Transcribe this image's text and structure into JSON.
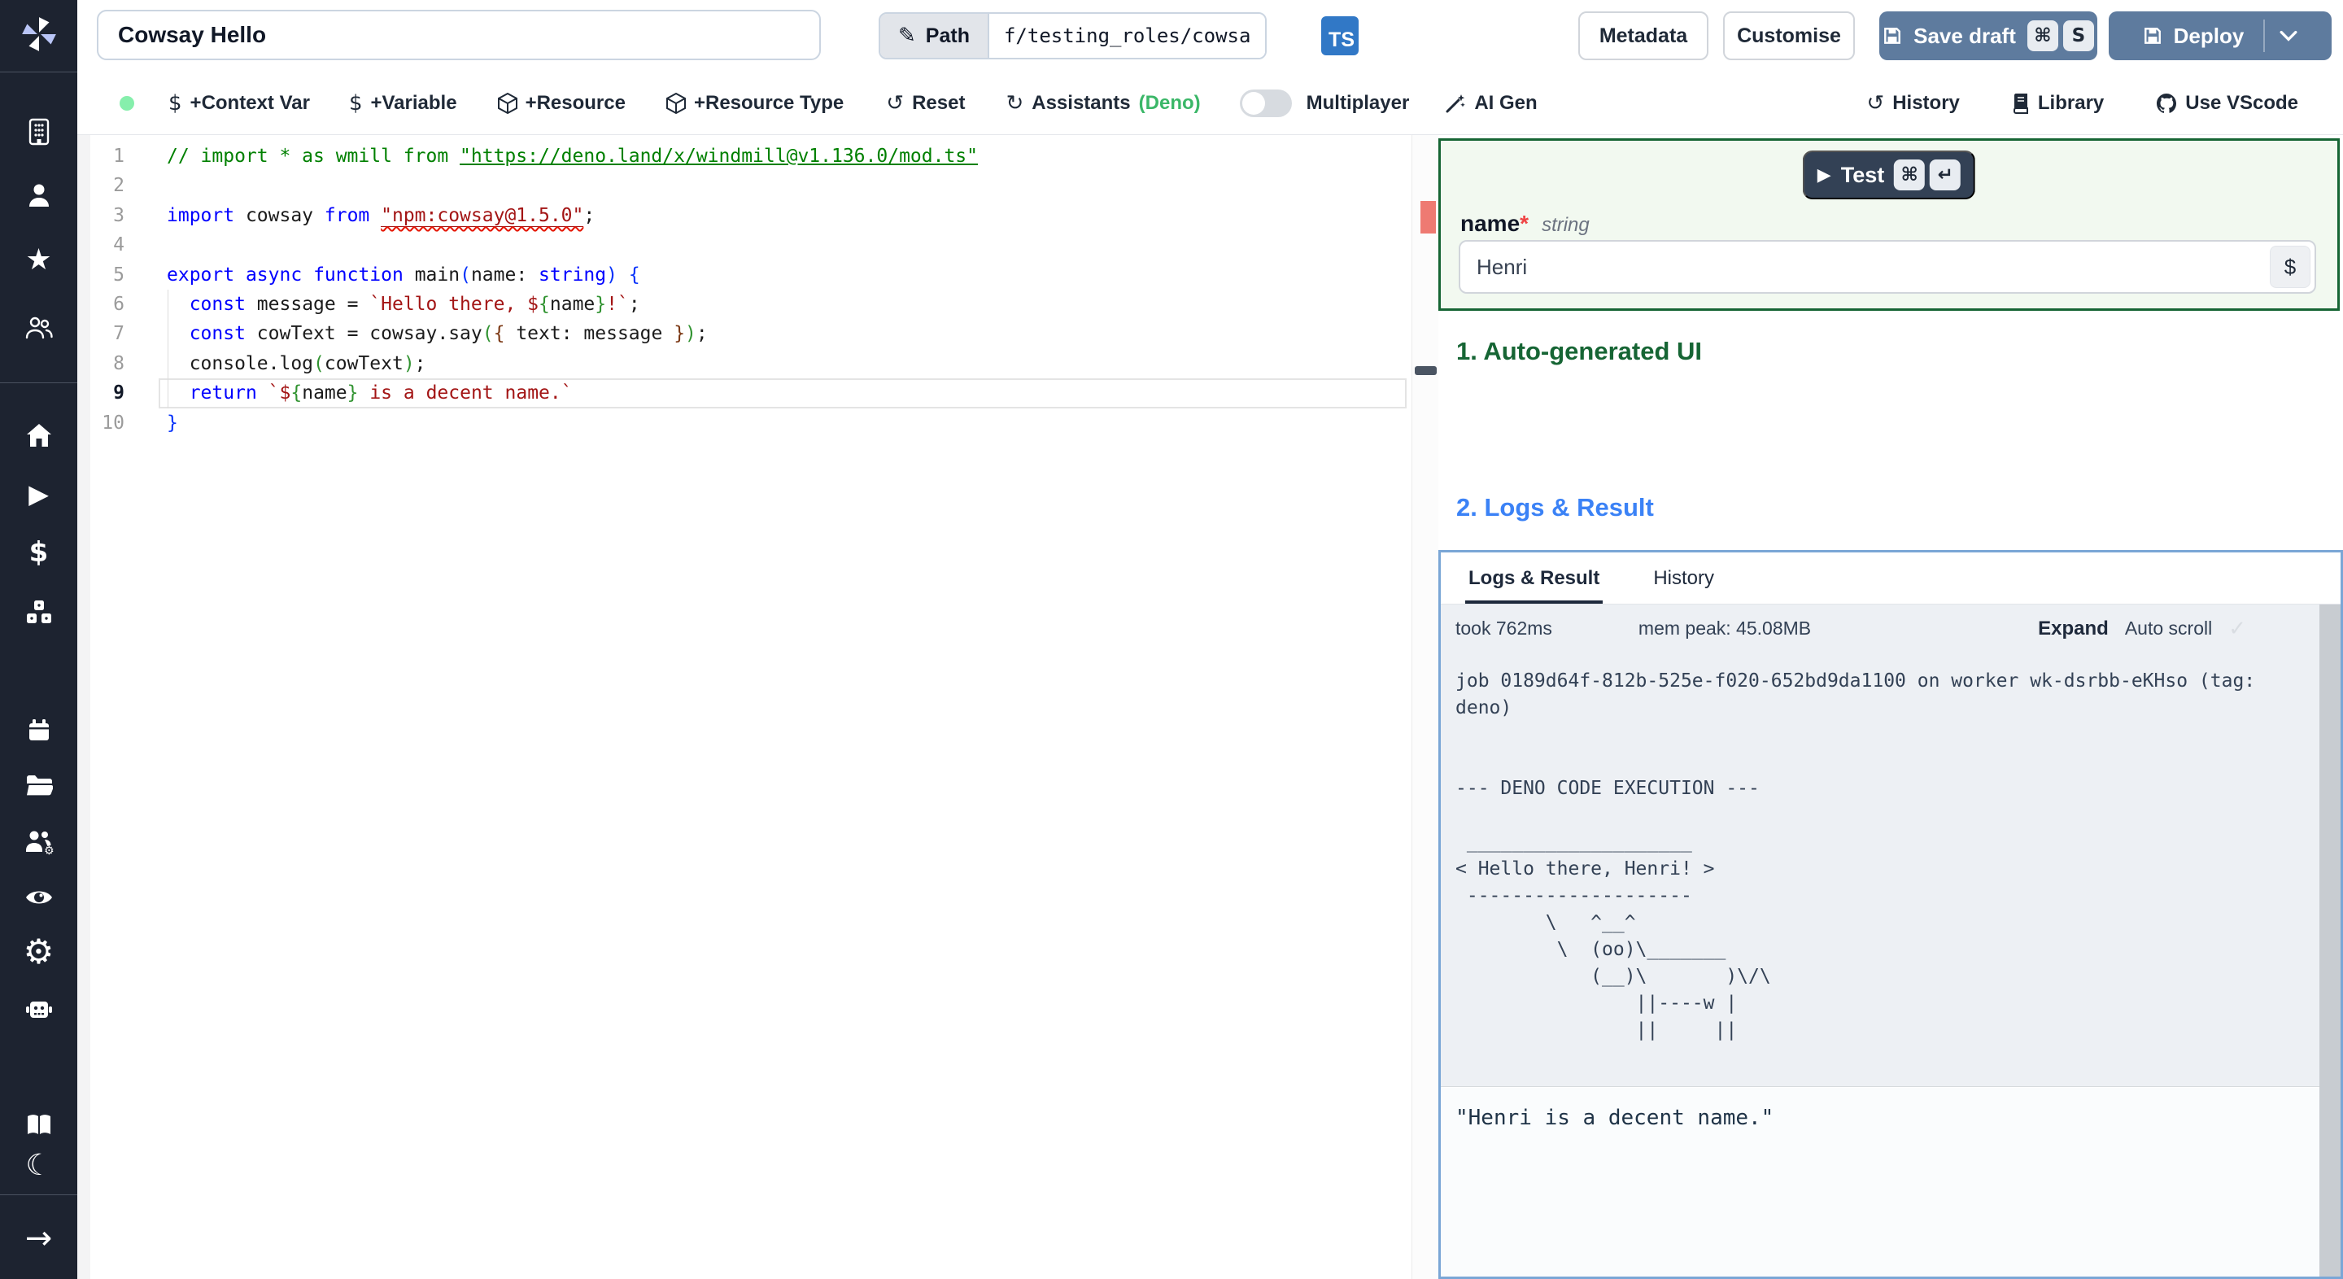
{
  "colors": {
    "accent_green": "#166534",
    "accent_blue": "#3b82f6",
    "button_slate": "#5e7b9e",
    "ts_badge": "#3178c6",
    "status_dot": "#86efac",
    "deno_green": "#3bb768",
    "error_mark": "#ee7a72"
  },
  "icons": {
    "pencil": "✎",
    "command": "⌘",
    "return": "↵",
    "play": "▶",
    "check": "✓",
    "reset": "↺",
    "refresh": "↻",
    "history": "↺",
    "star": "★",
    "gear": "⚙",
    "moon": "☾",
    "arrow_right": "→",
    "dollar": "$",
    "chevron_down": "v"
  },
  "header": {
    "title_value": "Cowsay Hello",
    "path_label": "Path",
    "path_value": "f/testing_roles/cowsa",
    "lang_badge": "TS",
    "metadata_label": "Metadata",
    "customise_label": "Customise",
    "save_draft_label": "Save draft",
    "save_draft_shortcut": [
      "⌘",
      "S"
    ],
    "deploy_label": "Deploy"
  },
  "toolbar": {
    "context_var": "+Context Var",
    "variable": "+Variable",
    "resource": "+Resource",
    "resource_type": "+Resource Type",
    "reset": "Reset",
    "assistants": "Assistants",
    "assistants_lang": "(Deno)",
    "multiplayer": "Multiplayer",
    "ai_gen": "AI Gen",
    "history": "History",
    "library": "Library",
    "use_vscode": "Use VScode"
  },
  "sidebar_items": [
    "windmill-logo",
    "workspace",
    "user",
    "favorites",
    "groups",
    "home",
    "runs",
    "variables",
    "resources",
    "schedules",
    "folders",
    "workers",
    "audit-logs",
    "settings",
    "ai",
    "docs",
    "dark-mode",
    "expand"
  ],
  "editor": {
    "active_line": 9,
    "lines": [
      {
        "n": 1,
        "tokens": [
          {
            "c": "c",
            "t": "// import * as wmill from "
          },
          {
            "c": "c u",
            "t": "\"https://deno.land/x/windmill@v1.136.0/mod.ts\""
          }
        ]
      },
      {
        "n": 2,
        "tokens": []
      },
      {
        "n": 3,
        "tokens": [
          {
            "c": "k",
            "t": "import"
          },
          {
            "c": "i",
            "t": " cowsay "
          },
          {
            "c": "k",
            "t": "from"
          },
          {
            "c": "i",
            "t": " "
          },
          {
            "c": "s sq",
            "t": "\"npm:cowsay@1.5.0\""
          },
          {
            "c": "i",
            "t": ";"
          }
        ]
      },
      {
        "n": 4,
        "tokens": []
      },
      {
        "n": 5,
        "tokens": [
          {
            "c": "k",
            "t": "export"
          },
          {
            "c": "i",
            "t": " "
          },
          {
            "c": "k",
            "t": "async"
          },
          {
            "c": "i",
            "t": " "
          },
          {
            "c": "k",
            "t": "function"
          },
          {
            "c": "i",
            "t": " main"
          },
          {
            "c": "b1",
            "t": "("
          },
          {
            "c": "i",
            "t": "name: "
          },
          {
            "c": "k",
            "t": "string"
          },
          {
            "c": "b1",
            "t": ")"
          },
          {
            "c": "i",
            "t": " "
          },
          {
            "c": "b1",
            "t": "{"
          }
        ]
      },
      {
        "n": 6,
        "tokens": [
          {
            "c": "i",
            "t": "  "
          },
          {
            "c": "k",
            "t": "const"
          },
          {
            "c": "i",
            "t": " message = "
          },
          {
            "c": "s",
            "t": "`Hello there, "
          },
          {
            "c": "s",
            "t": "$"
          },
          {
            "c": "b2",
            "t": "{"
          },
          {
            "c": "i",
            "t": "name"
          },
          {
            "c": "b2",
            "t": "}"
          },
          {
            "c": "s",
            "t": "!`"
          },
          {
            "c": "i",
            "t": ";"
          }
        ]
      },
      {
        "n": 7,
        "tokens": [
          {
            "c": "i",
            "t": "  "
          },
          {
            "c": "k",
            "t": "const"
          },
          {
            "c": "i",
            "t": " cowText = cowsay.say"
          },
          {
            "c": "b2",
            "t": "("
          },
          {
            "c": "b3",
            "t": "{"
          },
          {
            "c": "i",
            "t": " text: message "
          },
          {
            "c": "b3",
            "t": "}"
          },
          {
            "c": "b2",
            "t": ")"
          },
          {
            "c": "i",
            "t": ";"
          }
        ]
      },
      {
        "n": 8,
        "tokens": [
          {
            "c": "i",
            "t": "  console.log"
          },
          {
            "c": "b2",
            "t": "("
          },
          {
            "c": "i",
            "t": "cowText"
          },
          {
            "c": "b2",
            "t": ")"
          },
          {
            "c": "i",
            "t": ";"
          }
        ]
      },
      {
        "n": 9,
        "tokens": [
          {
            "c": "i",
            "t": "  "
          },
          {
            "c": "k",
            "t": "return"
          },
          {
            "c": "i",
            "t": " "
          },
          {
            "c": "s",
            "t": "`"
          },
          {
            "c": "s",
            "t": "$"
          },
          {
            "c": "b2",
            "t": "{"
          },
          {
            "c": "i",
            "t": "name"
          },
          {
            "c": "b2",
            "t": "}"
          },
          {
            "c": "s",
            "t": " is a decent name.`"
          }
        ]
      },
      {
        "n": 10,
        "tokens": [
          {
            "c": "b1",
            "t": "}"
          }
        ]
      }
    ]
  },
  "run_panel": {
    "test_label": "Test",
    "test_shortcut": [
      "⌘",
      "↵"
    ],
    "arg_name": "name",
    "arg_required": "*",
    "arg_type": "string",
    "arg_value": "Henri",
    "var_picker": "$",
    "ui_heading": "1. Auto-generated UI",
    "logs_heading": "2. Logs & Result"
  },
  "logs_panel": {
    "tabs": [
      "Logs & Result",
      "History"
    ],
    "active_tab": 0,
    "took": "took 762ms",
    "mem_peak": "mem peak: 45.08MB",
    "expand": "Expand",
    "autoscroll": "Auto scroll",
    "log_lines": [
      "job 0189d64f-812b-525e-f020-652bd9da1100 on worker wk-dsrbb-eKHso (tag:",
      "deno)",
      "",
      "",
      "--- DENO CODE EXECUTION ---",
      "",
      " ____________________",
      "< Hello there, Henri! >",
      " --------------------",
      "        \\   ^__^",
      "         \\  (oo)\\_______",
      "            (__)\\       )\\/\\",
      "                ||----w |",
      "                ||     ||"
    ],
    "result": "\"Henri is a decent name.\""
  }
}
